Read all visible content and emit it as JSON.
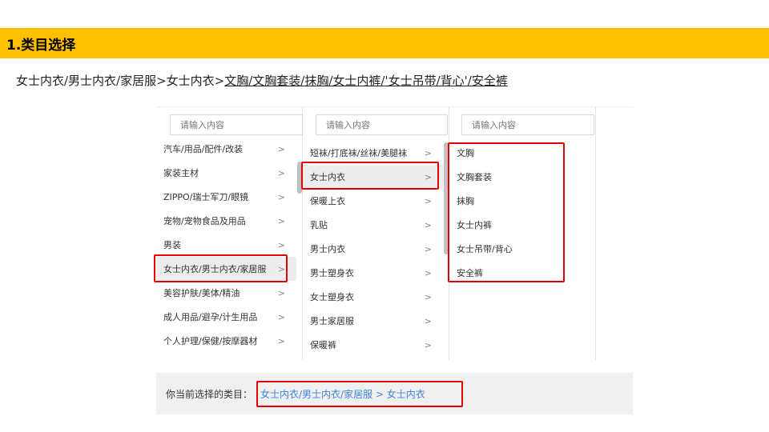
{
  "section": {
    "title": "1.类目选择"
  },
  "breadcrumb": {
    "prefix": "女士内衣/男士内衣/家居服>女士内衣>",
    "underlined": "文胸/文胸套装/抹胸/女士内裤/'女士吊带/背心'/安全裤"
  },
  "picker": {
    "col1": {
      "placeholder": "请输入内容",
      "items": [
        "汽车/用品/配件/改装",
        "家装主材",
        "ZIPPO/瑞士军刀/眼镜",
        "宠物/宠物食品及用品",
        "男装",
        "女士内衣/男士内衣/家居服",
        "美容护肤/美体/精油",
        "成人用品/避孕/计生用品",
        "个人护理/保健/按摩器材"
      ],
      "selected_index": 5
    },
    "col2": {
      "placeholder": "请输入内容",
      "items": [
        "短袜/打底袜/丝袜/美腿袜",
        "女士内衣",
        "保暖上衣",
        "乳贴",
        "男士内衣",
        "男士塑身衣",
        "女士塑身衣",
        "男士家居服",
        "保暖裤"
      ],
      "selected_index": 1
    },
    "col3": {
      "placeholder": "请输入内容",
      "items": [
        "文胸",
        "文胸套装",
        "抹胸",
        "女士内裤",
        "女士吊带/背心",
        "安全裤"
      ]
    },
    "chevron": ">"
  },
  "footer": {
    "label": "你当前选择的类目：",
    "path": "女士内衣/男士内衣/家居服 > 女士内衣"
  }
}
